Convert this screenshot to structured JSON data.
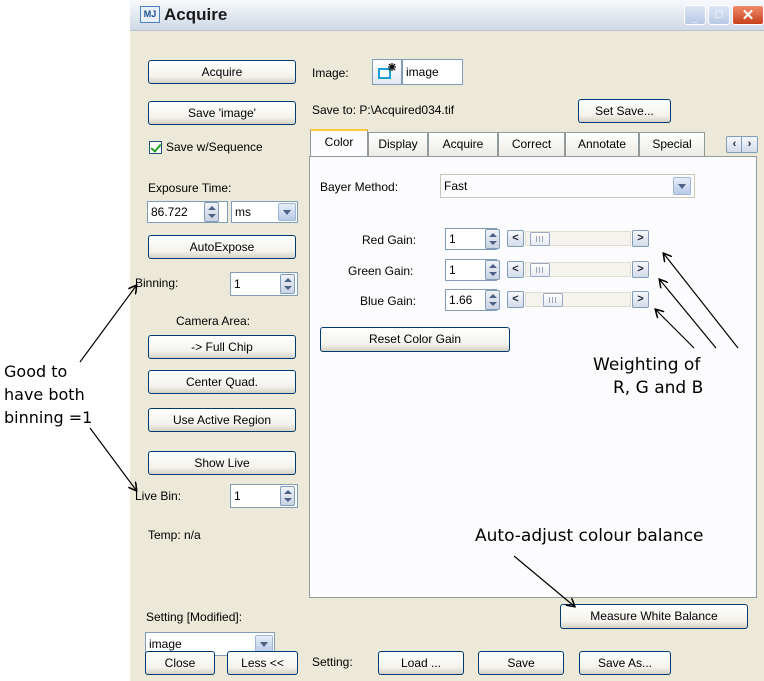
{
  "window": {
    "title": "Acquire"
  },
  "left": {
    "acquire_button": "Acquire",
    "save_image_button": "Save 'image'",
    "save_with_sequence": {
      "label": "Save w/Sequence",
      "checked": true
    },
    "exposure": {
      "label": "Exposure Time:",
      "value": "86.722",
      "unit": "ms"
    },
    "autoexpose_button": "AutoExpose",
    "binning": {
      "label": "Binning:",
      "value": "1"
    },
    "camera_area_label": "Camera Area:",
    "full_chip_button": "-> Full Chip",
    "center_quad_button": "Center Quad.",
    "use_active_region_button": "Use Active Region",
    "show_live_button": "Show Live",
    "live_bin": {
      "label": "Live Bin:",
      "value": "1"
    },
    "temp": "Temp: n/a",
    "setting_label": "Setting [Modified]:",
    "setting_value": "image",
    "close_button": "Close",
    "less_button": "Less <<"
  },
  "top": {
    "image_label": "Image:",
    "image_name": "image",
    "save_to": "Save to: P:\\Acquired034.tif",
    "set_save_button": "Set Save..."
  },
  "tabs": [
    "Color",
    "Display",
    "Acquire",
    "Correct",
    "Annotate",
    "Special"
  ],
  "color_tab": {
    "bayer_label": "Bayer Method:",
    "bayer_value": "Fast",
    "gains": [
      {
        "label": "Red Gain:",
        "value": "1",
        "slider": 0.05
      },
      {
        "label": "Green Gain:",
        "value": "1",
        "slider": 0.05
      },
      {
        "label": "Blue Gain:",
        "value": "1.66",
        "slider": 0.2
      }
    ],
    "reset_button": "Reset Color Gain",
    "measure_button": "Measure White Balance"
  },
  "bottom": {
    "setting_label": "Setting:",
    "load_button": "Load ...",
    "save_button": "Save",
    "save_as_button": "Save As..."
  },
  "annotations": {
    "binning_note": [
      "Good to",
      "have both",
      "binning =1"
    ],
    "weighting_note": [
      "Weighting of",
      "R, G and B"
    ],
    "auto_adjust_note": "Auto-adjust colour balance"
  },
  "colors": {
    "accent": "#ffc83c",
    "button_border": "#003c74",
    "checkmark": "#21a121"
  }
}
